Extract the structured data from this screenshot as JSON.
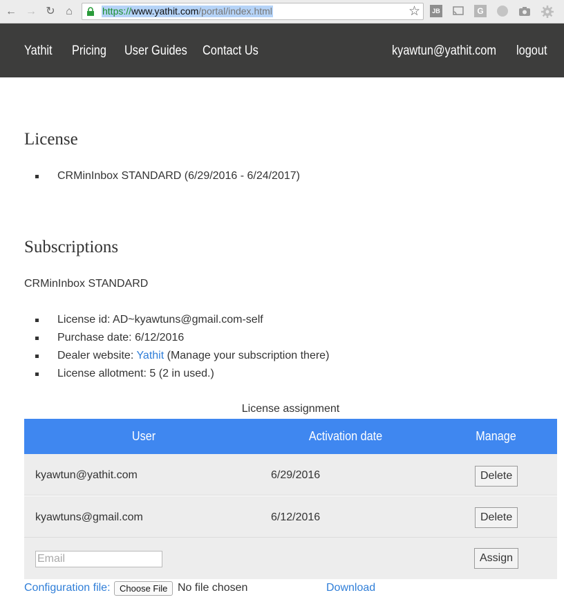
{
  "browser": {
    "url_scheme": "https://",
    "url_host": "www.yathit.com",
    "url_path": "/portal/index.html",
    "icons": [
      "back-icon",
      "forward-icon",
      "reload-icon",
      "home-icon",
      "lock-icon",
      "star-icon",
      "jb-extension-icon",
      "cast-icon",
      "g-extension-icon",
      "globe-extension-icon",
      "camera-extension-icon",
      "gear-extension-icon"
    ],
    "ext_jb": "JB",
    "ext_g": "G"
  },
  "nav": {
    "brand": "Yathit",
    "pricing": "Pricing",
    "user_guides": "User Guides",
    "contact_us": "Contact Us",
    "user_email": "kyawtun@yathit.com",
    "logout": "logout"
  },
  "license": {
    "heading": "License",
    "items": [
      "CRMinInbox STANDARD (6/29/2016 - 6/24/2017)"
    ]
  },
  "subscriptions": {
    "heading": "Subscriptions",
    "product": "CRMinInbox STANDARD",
    "license_id": "License id: AD~kyawtuns@gmail.com-self",
    "purchase_date": "Purchase date: 6/12/2016",
    "dealer_prefix": "Dealer website: ",
    "dealer_link": "Yathit",
    "dealer_suffix": " (Manage your subscription there)",
    "allotment": "License allotment: 5 (2 in used.)"
  },
  "assignment": {
    "caption": "License assignment",
    "columns": [
      "User",
      "Activation date",
      "Manage"
    ],
    "rows": [
      {
        "user": "kyawtun@yathit.com",
        "date": "6/29/2016",
        "action": "Delete"
      },
      {
        "user": "kyawtuns@gmail.com",
        "date": "6/12/2016",
        "action": "Delete"
      }
    ],
    "email_placeholder": "Email",
    "assign_label": "Assign"
  },
  "config": {
    "label": "Configuration file:",
    "choose_file": "Choose File",
    "no_file": "No file chosen",
    "download": "Download"
  },
  "colors": {
    "nav_bg": "#3d3d3c",
    "table_header_bg": "#3f87f0",
    "link": "#2f7ed8",
    "row_bg": "#ededed"
  }
}
